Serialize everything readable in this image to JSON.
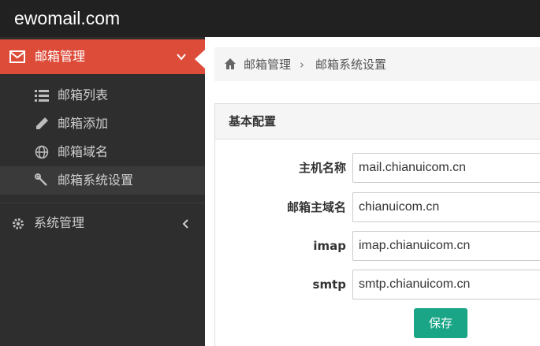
{
  "app": {
    "brand": "ewomail.com"
  },
  "sidebar": {
    "mail_menu": {
      "label": "邮箱管理"
    },
    "sub_items": [
      {
        "label": "邮箱列表",
        "icon": "list-icon"
      },
      {
        "label": "邮箱添加",
        "icon": "pencil-icon"
      },
      {
        "label": "邮箱域名",
        "icon": "globe-icon"
      },
      {
        "label": "邮箱系统设置",
        "icon": "wrench-icon"
      }
    ],
    "system_menu": {
      "label": "系统管理"
    }
  },
  "breadcrumb": {
    "root": "邮箱管理",
    "separator": "›",
    "current": "邮箱系统设置"
  },
  "panel": {
    "title": "基本配置",
    "fields": [
      {
        "label": "主机名称",
        "value": "mail.chianuicom.cn"
      },
      {
        "label": "邮箱主域名",
        "value": "chianuicom.cn"
      },
      {
        "label": "imap",
        "value": "imap.chianuicom.cn"
      },
      {
        "label": "smtp",
        "value": "smtp.chianuicom.cn"
      }
    ],
    "save_label": "保存"
  },
  "colors": {
    "topbar": "#212121",
    "sidebar": "#2e2e2e",
    "active": "#dd4b39",
    "button": "#1aa686"
  }
}
